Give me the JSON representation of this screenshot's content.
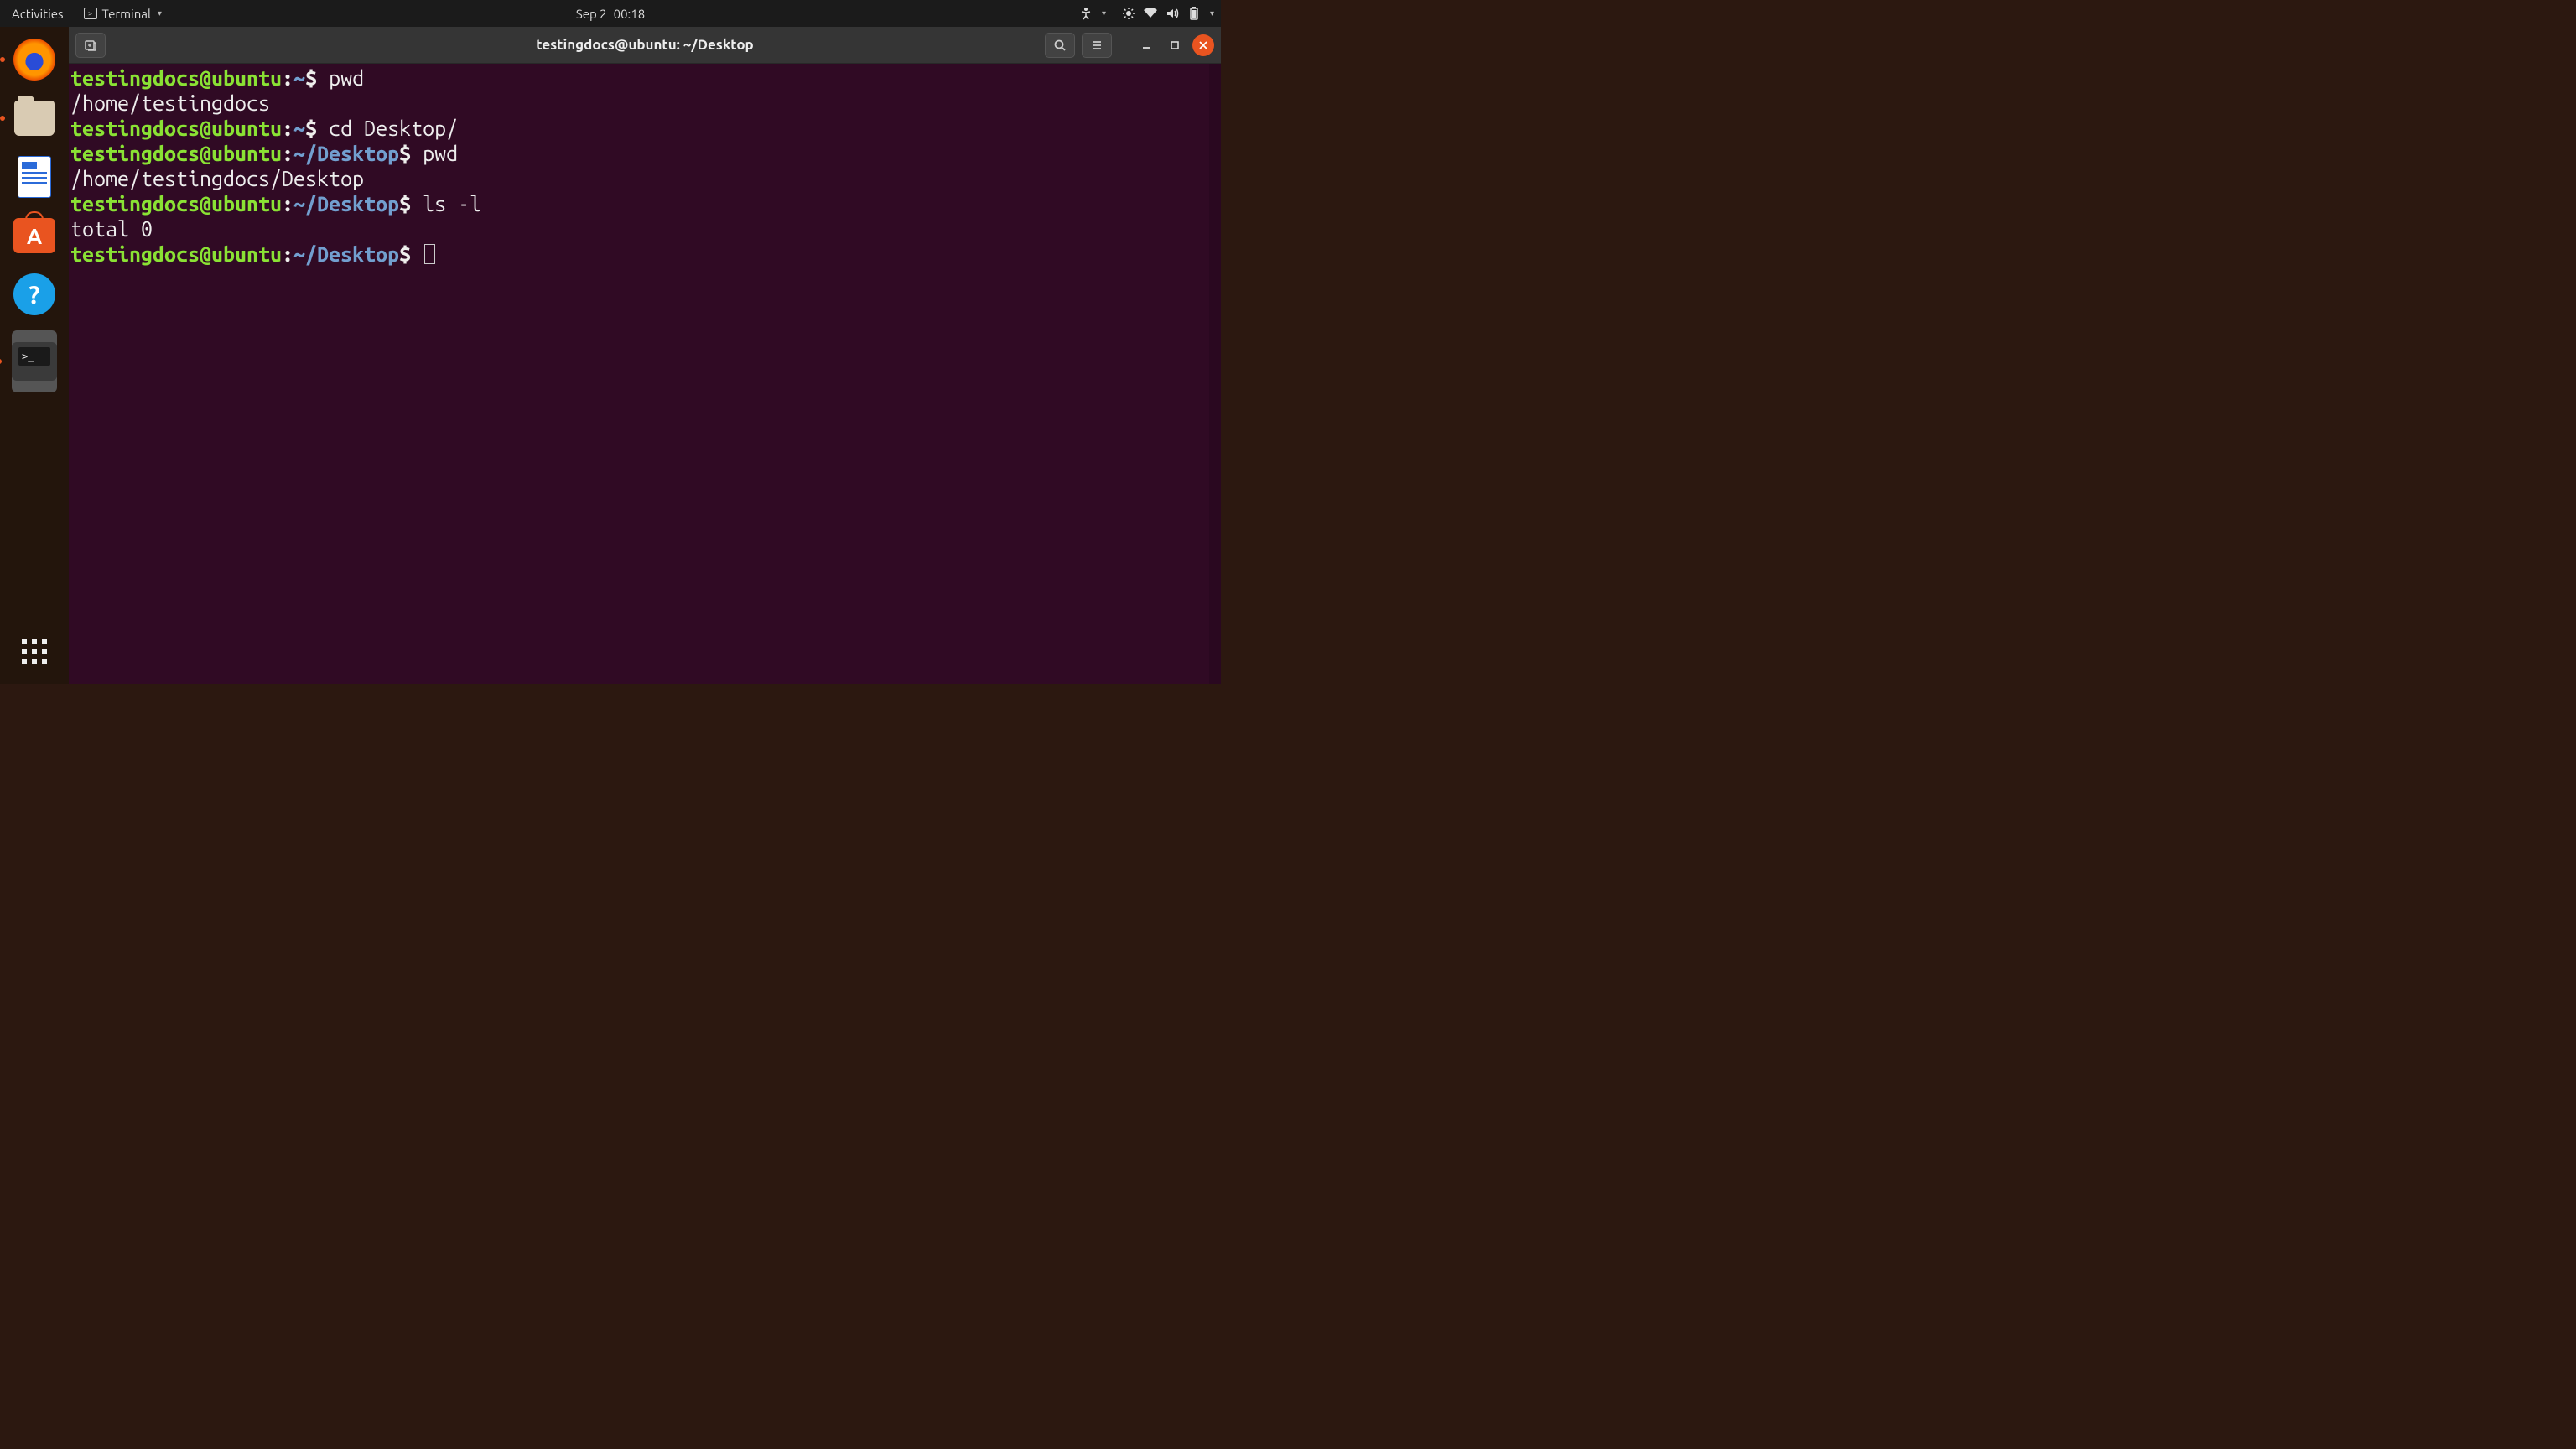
{
  "topbar": {
    "activities": "Activities",
    "app_name": "Terminal",
    "date": "Sep 2",
    "time": "00:18"
  },
  "dock": {
    "software_glyph": "A",
    "help_glyph": "?",
    "terminal_prompt": ">_"
  },
  "window": {
    "title": "testingdocs@ubuntu: ~/Desktop"
  },
  "terminal": {
    "prompts": {
      "user_host": "testingdocs@ubuntu",
      "colon": ":",
      "tilde": "~",
      "desktop": "~/Desktop",
      "dollar": "$"
    },
    "lines": [
      {
        "type": "prompt",
        "path": "~",
        "cmd": "pwd"
      },
      {
        "type": "output",
        "text": "/home/testingdocs"
      },
      {
        "type": "prompt",
        "path": "~",
        "cmd": "cd Desktop/"
      },
      {
        "type": "prompt",
        "path": "~/Desktop",
        "cmd": "pwd"
      },
      {
        "type": "output",
        "text": "/home/testingdocs/Desktop"
      },
      {
        "type": "prompt",
        "path": "~/Desktop",
        "cmd": "ls -l"
      },
      {
        "type": "output",
        "text": "total 0"
      },
      {
        "type": "prompt",
        "path": "~/Desktop",
        "cmd": "",
        "cursor": true
      }
    ]
  }
}
